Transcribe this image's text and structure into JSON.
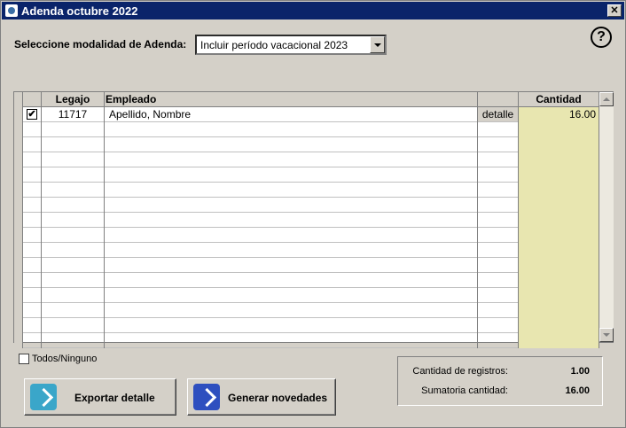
{
  "window": {
    "title": "Adenda octubre 2022",
    "close_label": "✕"
  },
  "help": {
    "symbol": "?"
  },
  "mode": {
    "label": "Seleccione modalidad de Adenda:",
    "selected": "Incluir período vacacional 2023"
  },
  "grid": {
    "columns": {
      "legajo": "Legajo",
      "empleado": "Empleado",
      "cantidad": "Cantidad"
    },
    "rows": [
      {
        "checked": "✔",
        "legajo": "11717",
        "empleado": "Apellido, Nombre",
        "detalle": "detalle",
        "cantidad": "16.00"
      }
    ]
  },
  "select_all": {
    "label": "Todos/Ninguno"
  },
  "buttons": {
    "export": "Exportar detalle",
    "generate": "Generar novedades"
  },
  "summary": {
    "count_label": "Cantidad de registros:",
    "count_value": "1.00",
    "sum_label": "Sumatoria cantidad:",
    "sum_value": "16.00"
  },
  "colors": {
    "titlebar": "#0a246a",
    "cantidad_column": "#e8e6b0",
    "export_icon": "#3aa6c9",
    "generate_icon": "#2e4fbf"
  }
}
